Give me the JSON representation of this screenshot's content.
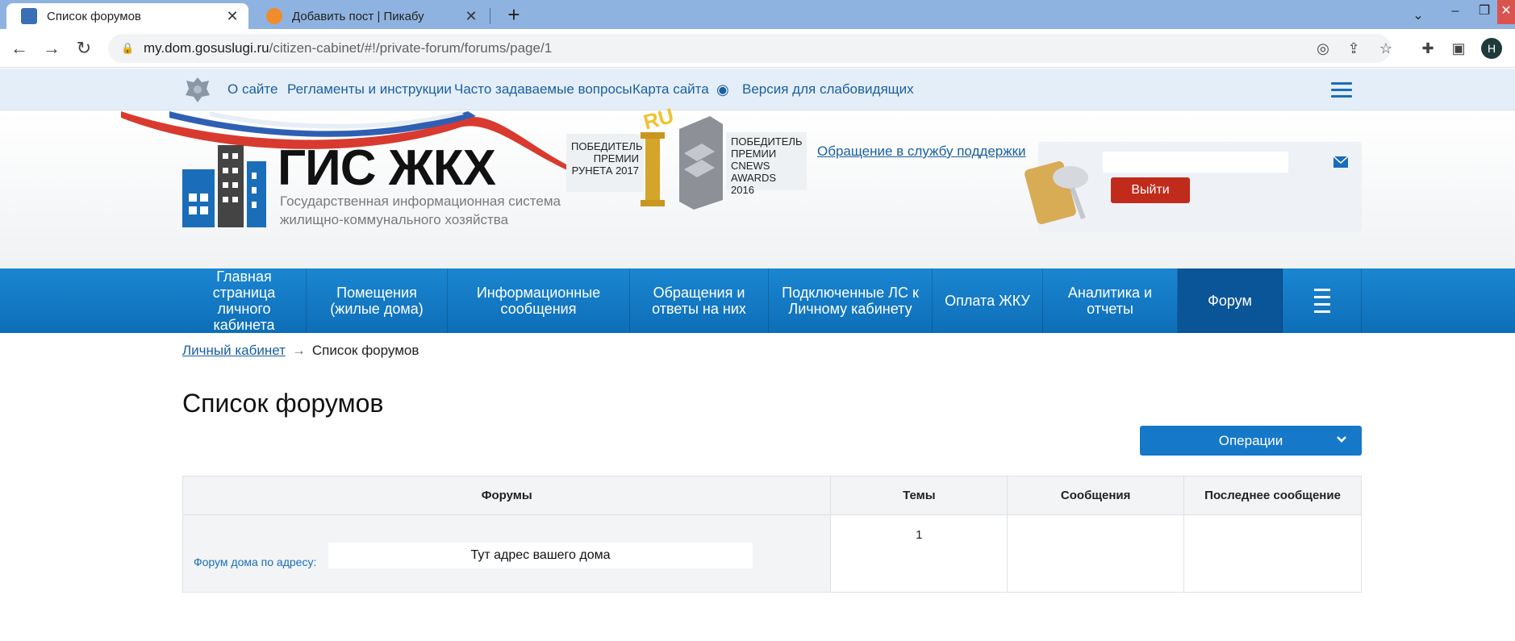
{
  "browser": {
    "tabs": [
      {
        "title": "Список форумов",
        "active": true
      },
      {
        "title": "Добавить пост | Пикабу",
        "active": false
      }
    ],
    "url_domain": "my.dom.gosuslugi.ru",
    "url_path": "/citizen-cabinet/#!/private-forum/forums/page/1",
    "profile_initial": "H"
  },
  "topbar": {
    "links": [
      "О сайте",
      "Регламенты и инструкции",
      "Часто задаваемые вопросы",
      "Карта сайта",
      "Версия для слабовидящих"
    ]
  },
  "header": {
    "logo_title": "ГИС ЖКХ",
    "logo_sub1": "Государственная информационная система",
    "logo_sub2": "жилищно-коммунального хозяйства",
    "award1": "ПОБЕДИТЕЛЬ ПРЕМИИ РУНЕТА 2017",
    "award2": "ПОБЕДИТЕЛЬ ПРЕМИИ CNEWS AWARDS 2016",
    "award_ru": "RU",
    "support_link": "Обращение в службу поддержки",
    "logout_label": "Выйти"
  },
  "nav": {
    "items": [
      "Главная страница личного кабинета",
      "Помещения (жилые дома)",
      "Информационные сообщения",
      "Обращения и ответы на них",
      "Подключенные ЛС к Личному кабинету",
      "Оплата ЖКУ",
      "Аналитика и отчеты",
      "Форум"
    ],
    "selected": "Форум"
  },
  "breadcrumb": {
    "link": "Личный кабинет",
    "arrow": "→",
    "current": "Список форумов"
  },
  "page": {
    "title": "Список форумов",
    "operations_label": "Операции"
  },
  "table": {
    "headers": [
      "Форумы",
      "Темы",
      "Сообщения",
      "Последнее сообщение"
    ],
    "rows": [
      {
        "forum_label": "Форум дома по адресу:",
        "address": "Тут адрес вашего дома",
        "topics": "1",
        "messages": "",
        "last_message": ""
      }
    ]
  },
  "colors": {
    "nav_blue": "#0e6eb8",
    "nav_selected": "#0a5597",
    "logout_red": "#c12b1b",
    "link_blue": "#1a5f9e"
  }
}
